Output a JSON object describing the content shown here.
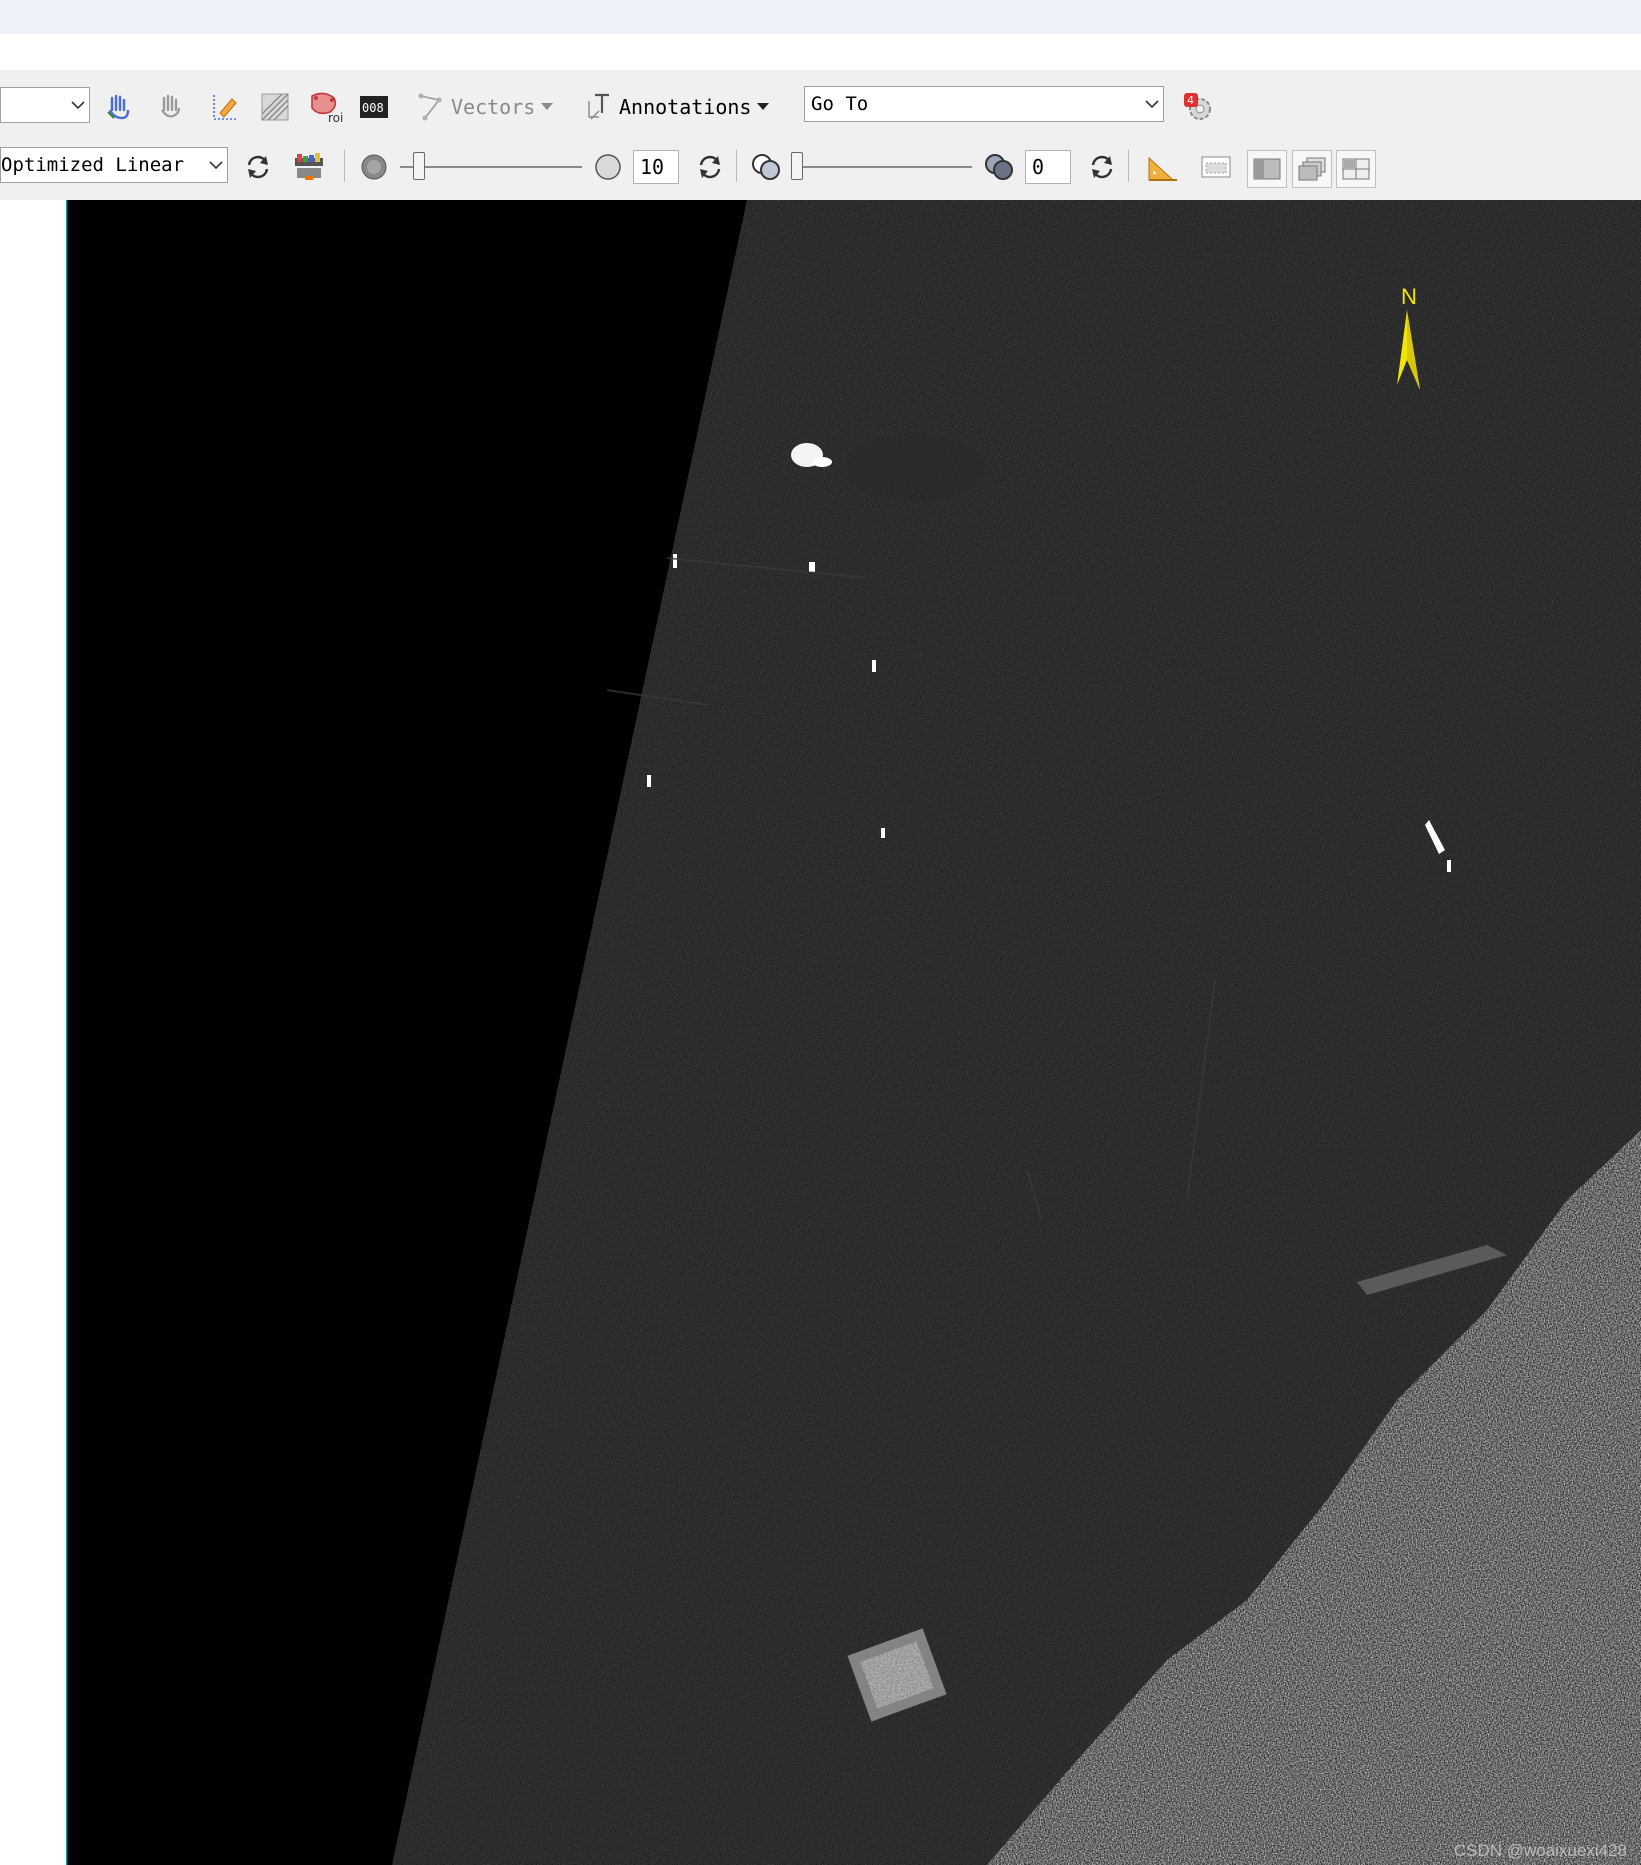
{
  "toolbar_row1": {
    "layer_combo_value": "",
    "vectors_label": "Vectors",
    "annotations_label": "Annotations",
    "goto_value": "Go To",
    "icons": [
      "pan-icon",
      "fly-icon",
      "crosshair-icon",
      "pixel-locator-icon",
      "roi-icon",
      "cursor-value-icon",
      "vectors-icon",
      "annotations-icon",
      "update-alert-icon"
    ]
  },
  "toolbar_row2": {
    "stretch_value": "Optimized Linear",
    "brightness_value": "10",
    "transparency_value": "0",
    "icons": [
      "reset-stretch-icon",
      "color-table-icon",
      "brightness-low-icon",
      "brightness-high-icon",
      "transparency-low-icon",
      "transparency-high-icon",
      "measure-icon",
      "portal-icon",
      "view-single-icon",
      "view-cascade-icon",
      "view-split-icon"
    ]
  },
  "map": {
    "north_label": "N",
    "watermark": "CSDN @woaixuexi428"
  },
  "colors": {
    "accent_north": "#f2e600",
    "viewer_edge": "#00a7b5",
    "toolbar_bg": "#f0f0f0",
    "header_bg": "#eef2f9"
  }
}
